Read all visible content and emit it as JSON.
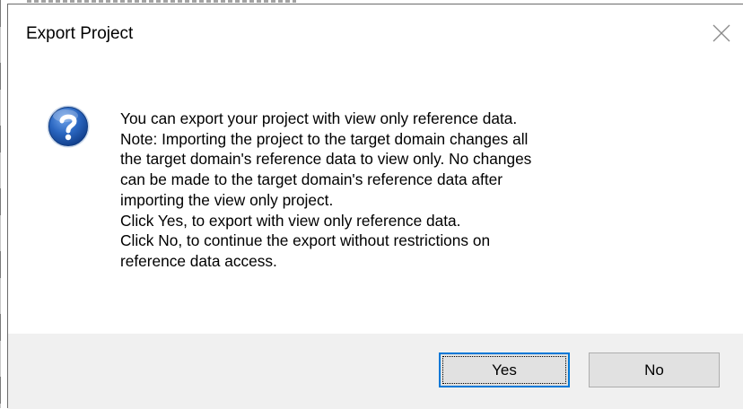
{
  "dialog": {
    "title": "Export Project",
    "close_icon": "close-icon",
    "icon": "question-icon",
    "message": "You can export your project with view only reference data.\nNote: Importing the project to the target domain changes all\nthe target domain's reference data to view only. No changes\ncan be made to the target domain's reference data after\nimporting the view only project.\nClick Yes, to export with view only reference data.\nClick No, to continue the export without restrictions on\nreference data access.",
    "buttons": {
      "yes": "Yes",
      "no": "No"
    },
    "colors": {
      "footer_bg": "#f0f0f0",
      "button_bg": "#e1e1e1",
      "focus_border": "#0078d7",
      "icon_blue": "#1f5fb4"
    }
  }
}
